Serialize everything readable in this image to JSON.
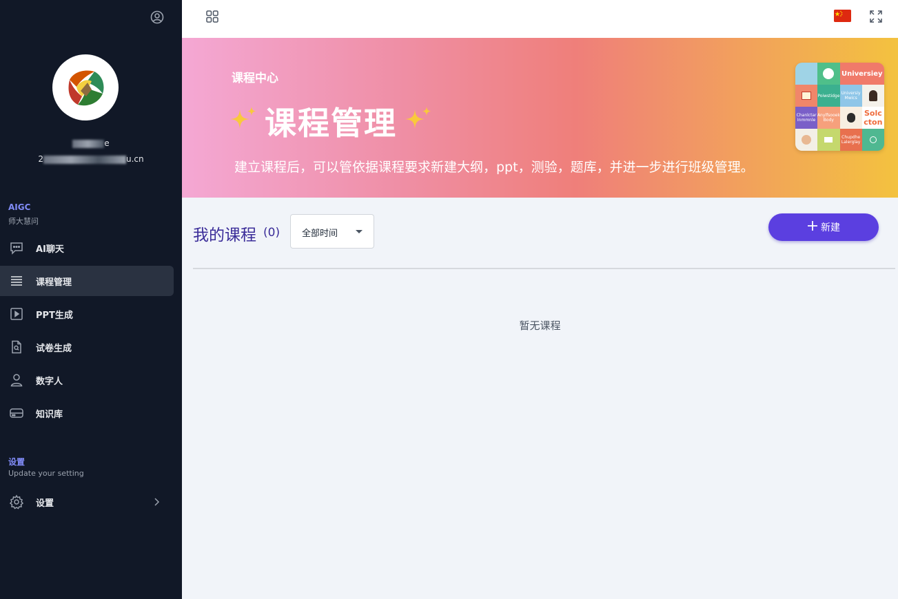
{
  "sidebar": {
    "user_name_suffix": "e",
    "user_email_prefix": "2",
    "user_email_suffix": "u.cn",
    "group_aigc": {
      "title": "AIGC",
      "subtitle": "师大慧问"
    },
    "items": [
      {
        "label": "AI聊天",
        "icon": "chat-icon"
      },
      {
        "label": "课程管理",
        "icon": "list-icon",
        "active": true
      },
      {
        "label": "PPT生成",
        "icon": "play-icon"
      },
      {
        "label": "试卷生成",
        "icon": "document-search-icon"
      },
      {
        "label": "数字人",
        "icon": "person-icon"
      },
      {
        "label": "知识库",
        "icon": "database-icon"
      }
    ],
    "group_settings": {
      "title": "设置",
      "subtitle": "Update your setting"
    },
    "settings_item": {
      "label": "设置",
      "icon": "gear-icon"
    }
  },
  "topbar": {
    "apps_icon": "grid-icon",
    "language_icon": "china-flag-icon",
    "fullscreen_icon": "fullscreen-icon"
  },
  "banner": {
    "kicker": "课程中心",
    "title": "课程管理",
    "description": "建立课程后，可以管依据课程要求新建大纲，ppt，测验，题库，并进一步进行班级管理。",
    "collage_texts": [
      "Universiey",
      "Poiwstidge",
      "Universiy Mwics",
      "Chanlctar Inmmnle",
      "Anylfsooek Body",
      "Solc cton",
      "Chupdhe Lalerglay"
    ]
  },
  "main": {
    "title": "我的课程",
    "count": "(0)",
    "time_filter": "全部时间",
    "new_button": "新建",
    "empty_text": "暂无课程"
  },
  "colors": {
    "sidebar_bg": "#111827",
    "accent": "#5b3fe0",
    "title_color": "#3b2d99",
    "group_title": "#818cf8"
  }
}
